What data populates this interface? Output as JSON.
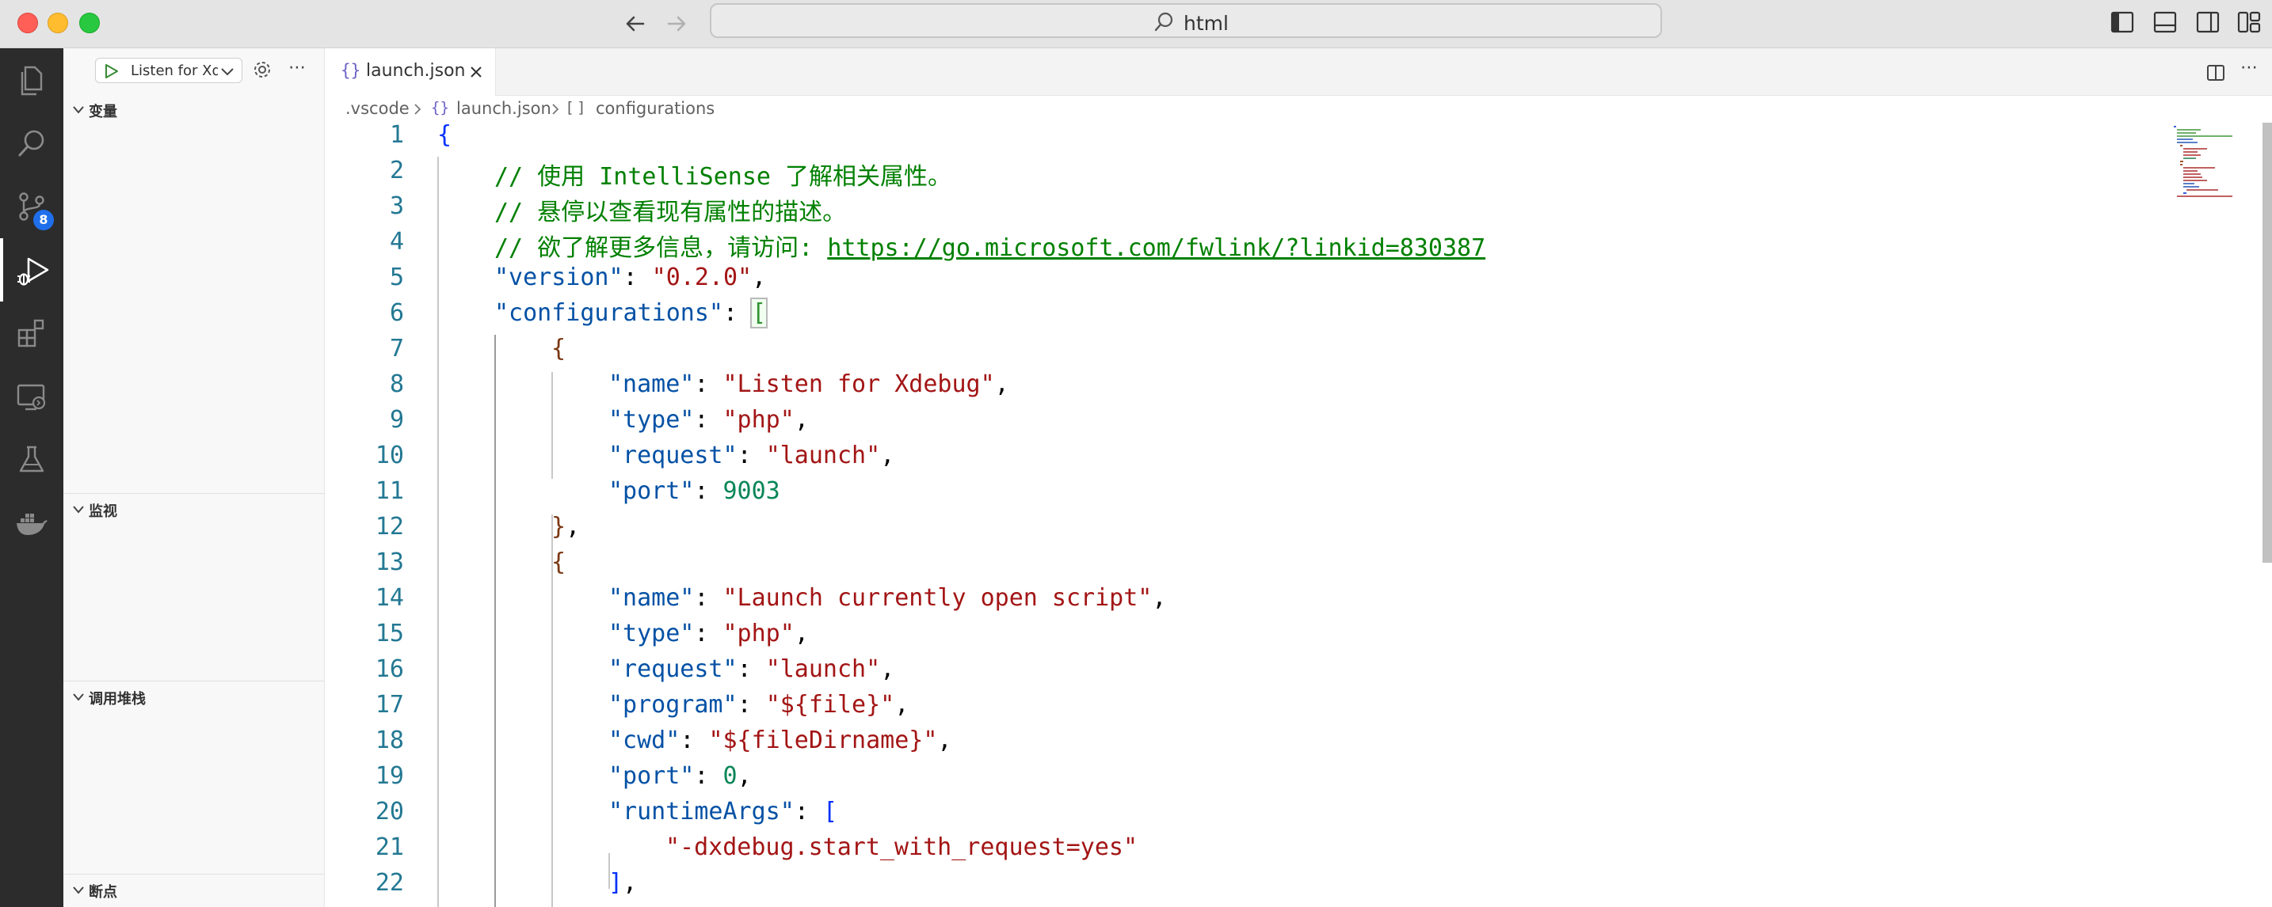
{
  "titlebar": {
    "command_center": "html"
  },
  "activity_bar": {
    "items": [
      {
        "name": "explorer"
      },
      {
        "name": "search"
      },
      {
        "name": "source-control",
        "badge": "8"
      },
      {
        "name": "run-and-debug",
        "active": true
      },
      {
        "name": "extensions"
      },
      {
        "name": "remote-explorer"
      },
      {
        "name": "testing"
      },
      {
        "name": "docker"
      }
    ]
  },
  "sidebar": {
    "config_select": "Listen for Xdebug",
    "sections": {
      "variables": "变量",
      "watch": "监视",
      "call_stack": "调用堆栈",
      "breakpoints": "断点"
    }
  },
  "editor": {
    "tab": {
      "icon": "{}",
      "label": "launch.json"
    },
    "breadcrumb": {
      "folder": ".vscode",
      "file_icon": "{}",
      "file": "launch.json",
      "symbol_icon": "[ ]",
      "symbol": "configurations"
    },
    "lines": [
      {
        "num": "1",
        "indent": 0,
        "tokens": [
          {
            "t": "{",
            "c": "b1"
          }
        ]
      },
      {
        "num": "2",
        "indent": 1,
        "tokens": [
          {
            "t": "// 使用 IntelliSense 了解相关属性。",
            "c": "c"
          }
        ]
      },
      {
        "num": "3",
        "indent": 1,
        "tokens": [
          {
            "t": "// 悬停以查看现有属性的描述。",
            "c": "c"
          }
        ]
      },
      {
        "num": "4",
        "indent": 1,
        "tokens": [
          {
            "t": "// 欲了解更多信息，请访问: ",
            "c": "c"
          },
          {
            "t": "https://go.microsoft.com/fwlink/?linkid=830387",
            "c": "cl"
          }
        ]
      },
      {
        "num": "5",
        "indent": 1,
        "tokens": [
          {
            "t": "\"version\"",
            "c": "k"
          },
          {
            "t": ": ",
            "c": "p"
          },
          {
            "t": "\"0.2.0\"",
            "c": "s"
          },
          {
            "t": ",",
            "c": "p"
          }
        ]
      },
      {
        "num": "6",
        "indent": 1,
        "tokens": [
          {
            "t": "\"configurations\"",
            "c": "k"
          },
          {
            "t": ": ",
            "c": "p"
          },
          {
            "t": "[",
            "c": "b2 bracket-match"
          }
        ]
      },
      {
        "num": "7",
        "indent": 2,
        "tokens": [
          {
            "t": "{",
            "c": "b3"
          }
        ]
      },
      {
        "num": "8",
        "indent": 3,
        "tokens": [
          {
            "t": "\"name\"",
            "c": "k"
          },
          {
            "t": ": ",
            "c": "p"
          },
          {
            "t": "\"Listen for Xdebug\"",
            "c": "s"
          },
          {
            "t": ",",
            "c": "p"
          }
        ]
      },
      {
        "num": "9",
        "indent": 3,
        "tokens": [
          {
            "t": "\"type\"",
            "c": "k"
          },
          {
            "t": ": ",
            "c": "p"
          },
          {
            "t": "\"php\"",
            "c": "s"
          },
          {
            "t": ",",
            "c": "p"
          }
        ]
      },
      {
        "num": "10",
        "indent": 3,
        "tokens": [
          {
            "t": "\"request\"",
            "c": "k"
          },
          {
            "t": ": ",
            "c": "p"
          },
          {
            "t": "\"launch\"",
            "c": "s"
          },
          {
            "t": ",",
            "c": "p"
          }
        ]
      },
      {
        "num": "11",
        "indent": 3,
        "tokens": [
          {
            "t": "\"port\"",
            "c": "k"
          },
          {
            "t": ": ",
            "c": "p"
          },
          {
            "t": "9003",
            "c": "n"
          }
        ]
      },
      {
        "num": "12",
        "indent": 2,
        "tokens": [
          {
            "t": "}",
            "c": "b3"
          },
          {
            "t": ",",
            "c": "p"
          }
        ]
      },
      {
        "num": "13",
        "indent": 2,
        "tokens": [
          {
            "t": "{",
            "c": "b3"
          }
        ]
      },
      {
        "num": "14",
        "indent": 3,
        "tokens": [
          {
            "t": "\"name\"",
            "c": "k"
          },
          {
            "t": ": ",
            "c": "p"
          },
          {
            "t": "\"Launch currently open script\"",
            "c": "s"
          },
          {
            "t": ",",
            "c": "p"
          }
        ]
      },
      {
        "num": "15",
        "indent": 3,
        "tokens": [
          {
            "t": "\"type\"",
            "c": "k"
          },
          {
            "t": ": ",
            "c": "p"
          },
          {
            "t": "\"php\"",
            "c": "s"
          },
          {
            "t": ",",
            "c": "p"
          }
        ]
      },
      {
        "num": "16",
        "indent": 3,
        "tokens": [
          {
            "t": "\"request\"",
            "c": "k"
          },
          {
            "t": ": ",
            "c": "p"
          },
          {
            "t": "\"launch\"",
            "c": "s"
          },
          {
            "t": ",",
            "c": "p"
          }
        ]
      },
      {
        "num": "17",
        "indent": 3,
        "tokens": [
          {
            "t": "\"program\"",
            "c": "k"
          },
          {
            "t": ": ",
            "c": "p"
          },
          {
            "t": "\"${file}\"",
            "c": "s"
          },
          {
            "t": ",",
            "c": "p"
          }
        ]
      },
      {
        "num": "18",
        "indent": 3,
        "tokens": [
          {
            "t": "\"cwd\"",
            "c": "k"
          },
          {
            "t": ": ",
            "c": "p"
          },
          {
            "t": "\"${fileDirname}\"",
            "c": "s"
          },
          {
            "t": ",",
            "c": "p"
          }
        ]
      },
      {
        "num": "19",
        "indent": 3,
        "tokens": [
          {
            "t": "\"port\"",
            "c": "k"
          },
          {
            "t": ": ",
            "c": "p"
          },
          {
            "t": "0",
            "c": "n"
          },
          {
            "t": ",",
            "c": "p"
          }
        ]
      },
      {
        "num": "20",
        "indent": 3,
        "tokens": [
          {
            "t": "\"runtimeArgs\"",
            "c": "k"
          },
          {
            "t": ": ",
            "c": "p"
          },
          {
            "t": "[",
            "c": "b1"
          }
        ]
      },
      {
        "num": "21",
        "indent": 4,
        "tokens": [
          {
            "t": "\"-dxdebug.start_with_request=yes\"",
            "c": "s"
          }
        ]
      },
      {
        "num": "22",
        "indent": 3,
        "tokens": [
          {
            "t": "]",
            "c": "b1"
          },
          {
            "t": ",",
            "c": "p"
          }
        ]
      }
    ]
  }
}
